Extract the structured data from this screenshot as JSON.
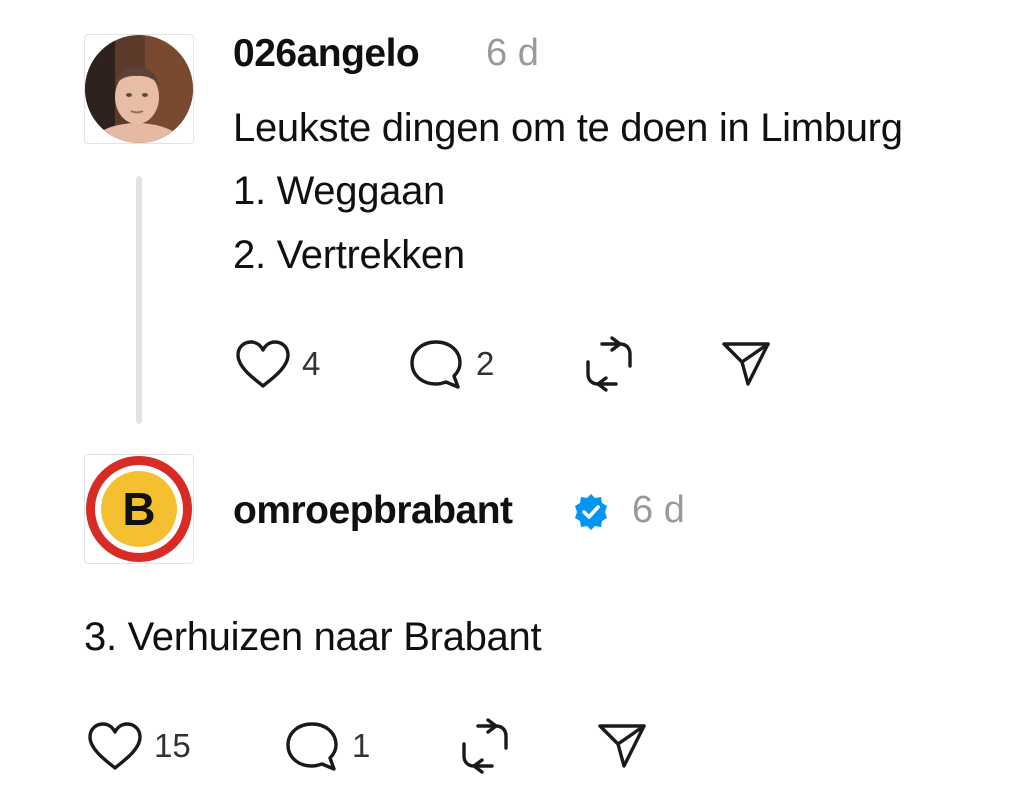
{
  "posts": [
    {
      "username": "026angelo",
      "time": "6 d",
      "lines": [
        "Leukste dingen om te doen in Limburg",
        "1. Weggaan",
        "2. Vertrekken"
      ],
      "likes": "4",
      "replies": "2",
      "avatar_icon": "user-photo-avatar"
    },
    {
      "username": "omroepbrabant",
      "time": "6 d",
      "verified": true,
      "lines": [
        "3. Verhuizen naar Brabant"
      ],
      "likes": "15",
      "replies": "1",
      "avatar_icon": "omroep-brabant-logo",
      "logo_letter": "B"
    }
  ],
  "colors": {
    "verified_blue": "#0095f6",
    "brabant_red": "#d92b25",
    "brabant_yellow": "#f5c030"
  },
  "icons": [
    "heart-icon",
    "comment-icon",
    "repost-icon",
    "share-icon",
    "verified-badge-icon"
  ]
}
